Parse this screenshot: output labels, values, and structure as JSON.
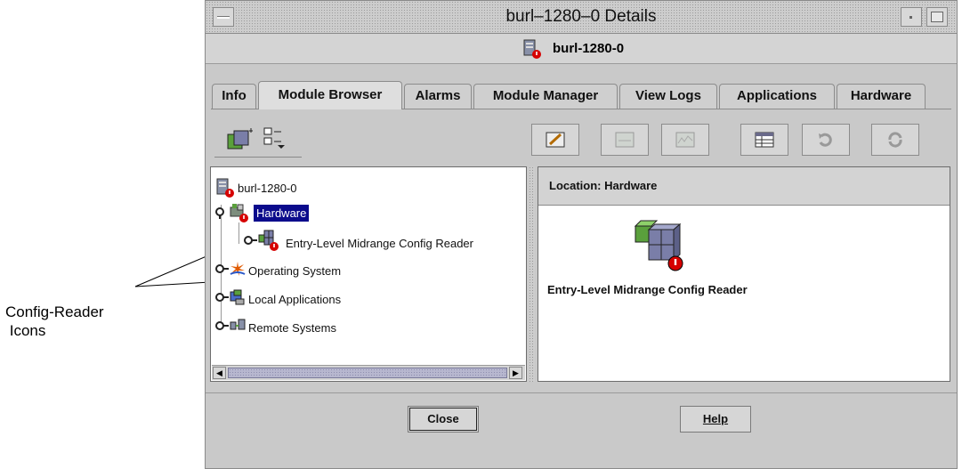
{
  "callout": {
    "lines": [
      "Config-Reader",
      " Icons"
    ]
  },
  "window": {
    "title": "burl–1280–0 Details",
    "host": "burl-1280-0"
  },
  "tabs": [
    {
      "label": "Info",
      "active": false
    },
    {
      "label": "Module Browser",
      "active": true
    },
    {
      "label": "Alarms",
      "active": false
    },
    {
      "label": "Module Manager",
      "active": false
    },
    {
      "label": "View Logs",
      "active": false
    },
    {
      "label": "Applications",
      "active": false
    },
    {
      "label": "Hardware",
      "active": false
    }
  ],
  "toolbar": {
    "left_icons": [
      "module-view-icon",
      "tree-options-icon"
    ],
    "right_icons": [
      "edit-icon",
      "graph-icon",
      "chart-icon",
      "table-icon",
      "refresh-icon",
      "reload-icon"
    ]
  },
  "tree": {
    "root": "burl-1280-0",
    "items": [
      {
        "label": "Hardware",
        "selected": true,
        "icon": "hardware-icon",
        "alarm": true
      },
      {
        "label": "Entry-Level Midrange Config Reader",
        "selected": false,
        "icon": "config-reader-icon",
        "alarm": true
      },
      {
        "label": "Operating System",
        "selected": false,
        "icon": "os-icon",
        "alarm": false
      },
      {
        "label": "Local Applications",
        "selected": false,
        "icon": "local-apps-icon",
        "alarm": false
      },
      {
        "label": "Remote Systems",
        "selected": false,
        "icon": "remote-systems-icon",
        "alarm": false
      }
    ]
  },
  "location": {
    "label": "Location:",
    "value": "Hardware"
  },
  "module": {
    "label": "Entry-Level Midrange Config Reader"
  },
  "buttons": {
    "close": "Close",
    "help": "Help"
  },
  "colors": {
    "selection": "#0b0b8c",
    "alarm": "#d60000",
    "window_bg": "#c9c9c9"
  }
}
